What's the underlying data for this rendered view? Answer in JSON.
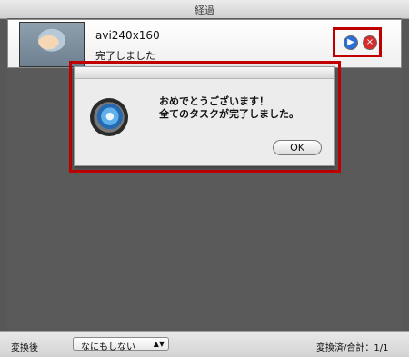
{
  "window": {
    "title": "経過"
  },
  "task": {
    "filename": "avi240x160",
    "status": "完了しました"
  },
  "dialog": {
    "message_line1": "おめでとうございます！",
    "message_line2": "全てのタスクが完了しました。",
    "ok_label": "OK"
  },
  "bottom": {
    "after_label": "変換後",
    "after_value": "なにもしない",
    "summary": "変換済/合計：1/1"
  },
  "icons": {
    "play": "play-icon",
    "close": "close-icon",
    "app": "app-icon"
  }
}
